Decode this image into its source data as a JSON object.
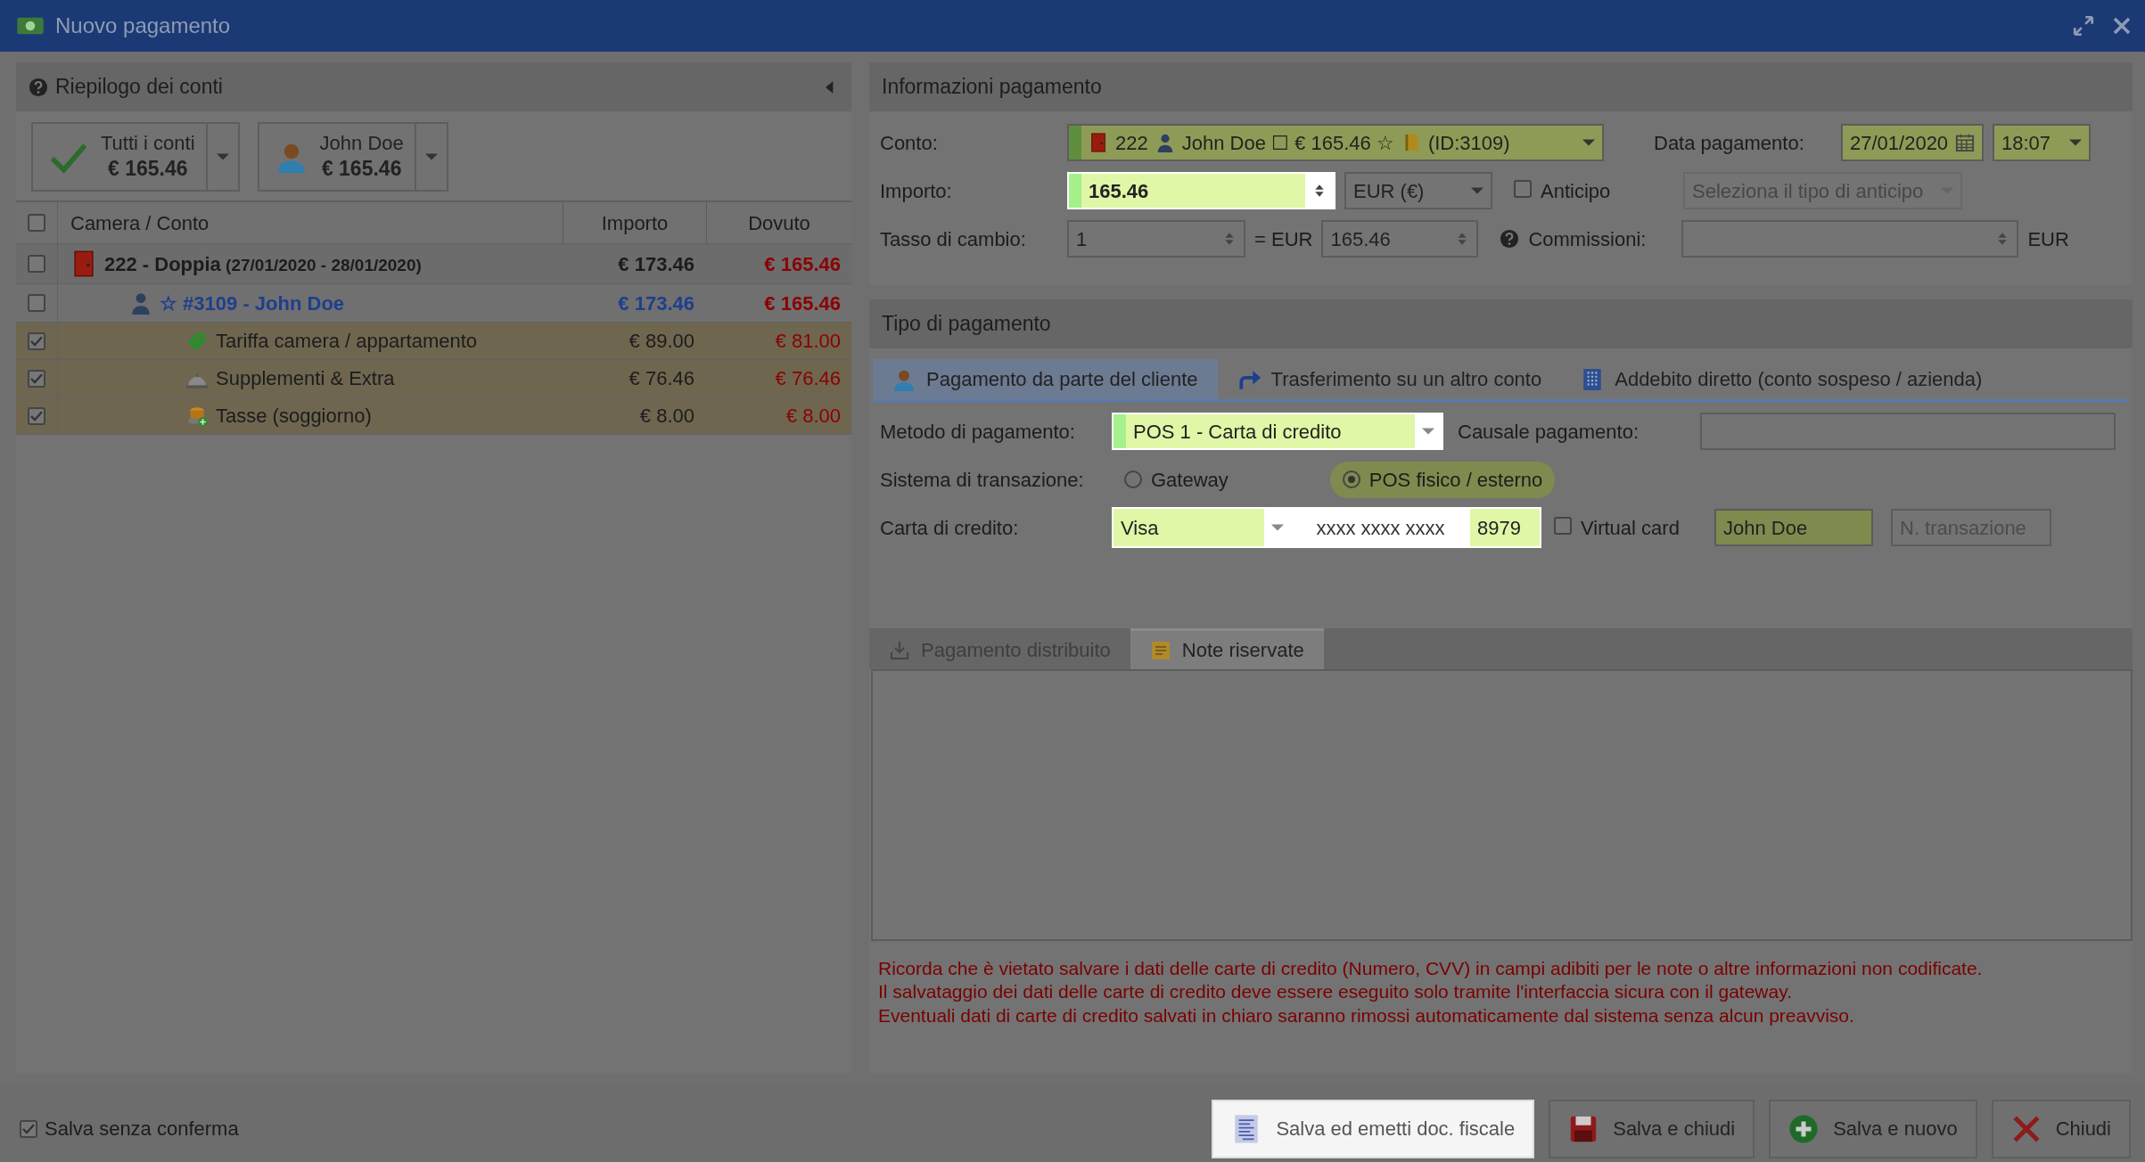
{
  "window": {
    "title": "Nuovo pagamento"
  },
  "summary_panel": {
    "title": "Riepilogo dei conti",
    "account_buttons": [
      {
        "kind": "all",
        "label": "Tutti i conti",
        "amount": "€ 165.46"
      },
      {
        "kind": "guest",
        "label": "John Doe",
        "amount": "€ 165.46"
      }
    ],
    "table": {
      "all_checked": false,
      "columns": [
        "Camera / Conto",
        "Importo",
        "Dovuto"
      ],
      "rows": [
        {
          "kind": "room",
          "checked": false,
          "label": "222 - Doppia",
          "dates": "(27/01/2020 - 28/01/2020)",
          "importo": "€ 173.46",
          "dovuto": "€ 165.46"
        },
        {
          "kind": "guest",
          "checked": false,
          "label": "☆ #3109 - John Doe",
          "importo": "€ 173.46",
          "dovuto": "€ 165.46"
        },
        {
          "kind": "rate",
          "checked": true,
          "label": "Tariffa camera / appartamento",
          "importo": "€ 89.00",
          "dovuto": "€ 81.00"
        },
        {
          "kind": "extras",
          "checked": true,
          "label": "Supplementi & Extra",
          "importo": "€ 76.46",
          "dovuto": "€ 76.46"
        },
        {
          "kind": "tax",
          "checked": true,
          "label": "Tasse (soggiorno)",
          "importo": "€ 8.00",
          "dovuto": "€ 8.00"
        }
      ]
    }
  },
  "payment_info": {
    "title": "Informazioni pagamento",
    "conto_label": "Conto:",
    "conto": {
      "room": "222",
      "guest": "John Doe ☐ € 165.46 ☆",
      "id": "(ID:3109)"
    },
    "date_label": "Data pagamento:",
    "date": "27/01/2020",
    "time": "18:07",
    "importo_label": "Importo:",
    "importo": "165.46",
    "currency": "EUR (€)",
    "anticipo": {
      "label": "Anticipo",
      "checked": false
    },
    "advance_type": {
      "placeholder": "Seleziona il tipo di anticipo"
    },
    "tasso_label": "Tasso di cambio:",
    "tasso": "1",
    "equals_label": "= EUR",
    "converted": "165.46",
    "commissioni_label": "Commissioni:",
    "commissioni_unit": "EUR"
  },
  "payment_type": {
    "title": "Tipo di pagamento",
    "tabs": [
      {
        "kind": "person",
        "label": "Pagamento da parte del cliente",
        "selected": true
      },
      {
        "kind": "transfer",
        "label": "Trasferimento su un altro conto",
        "selected": false
      },
      {
        "kind": "building",
        "label": "Addebito diretto (conto sospeso / azienda)",
        "selected": false
      }
    ],
    "metodo_label": "Metodo di pagamento:",
    "metodo": "POS 1 - Carta di credito",
    "causale_label": "Causale pagamento:",
    "sistema_label": "Sistema di transazione:",
    "sistema_options": [
      {
        "label": "Gateway",
        "selected": false
      },
      {
        "label": "POS fisico / esterno",
        "selected": true
      }
    ],
    "carta_label": "Carta di credito:",
    "card_type": "Visa",
    "card_mask": "xxxx xxxx xxxx",
    "card_last": "8979",
    "virtual_card": {
      "label": "Virtual card",
      "checked": false
    },
    "holder": "John Doe",
    "transaction": {
      "placeholder": "N. transazione"
    }
  },
  "notes": {
    "tabs": [
      {
        "kind": "distributed",
        "label": "Pagamento distribuito",
        "selected": false,
        "disabled": true
      },
      {
        "kind": "note",
        "label": "Note riservate",
        "selected": true,
        "disabled": false
      }
    ]
  },
  "warnings": [
    "Ricorda che è vietato salvare i dati delle carte di credito (Numero, CVV) in campi adibiti per le note o altre informazioni non codificate.",
    "Il salvataggio dei dati delle carte di credito deve essere eseguito solo tramite l'interfaccia sicura con il gateway.",
    "Eventuali dati di carte di credito salvati in chiaro saranno rimossi automaticamente dal sistema senza alcun preavviso."
  ],
  "footer": {
    "save_without_confirm": {
      "label": "Salva senza conferma",
      "checked": true
    },
    "buttons": [
      {
        "kind": "fiscal",
        "label": "Salva ed emetti doc. fiscale",
        "highlighted": true
      },
      {
        "kind": "save_close",
        "label": "Salva e chiudi",
        "highlighted": false
      },
      {
        "kind": "save_new",
        "label": "Salva e nuovo",
        "highlighted": false
      },
      {
        "kind": "close",
        "label": "Chiudi",
        "highlighted": false
      }
    ]
  }
}
